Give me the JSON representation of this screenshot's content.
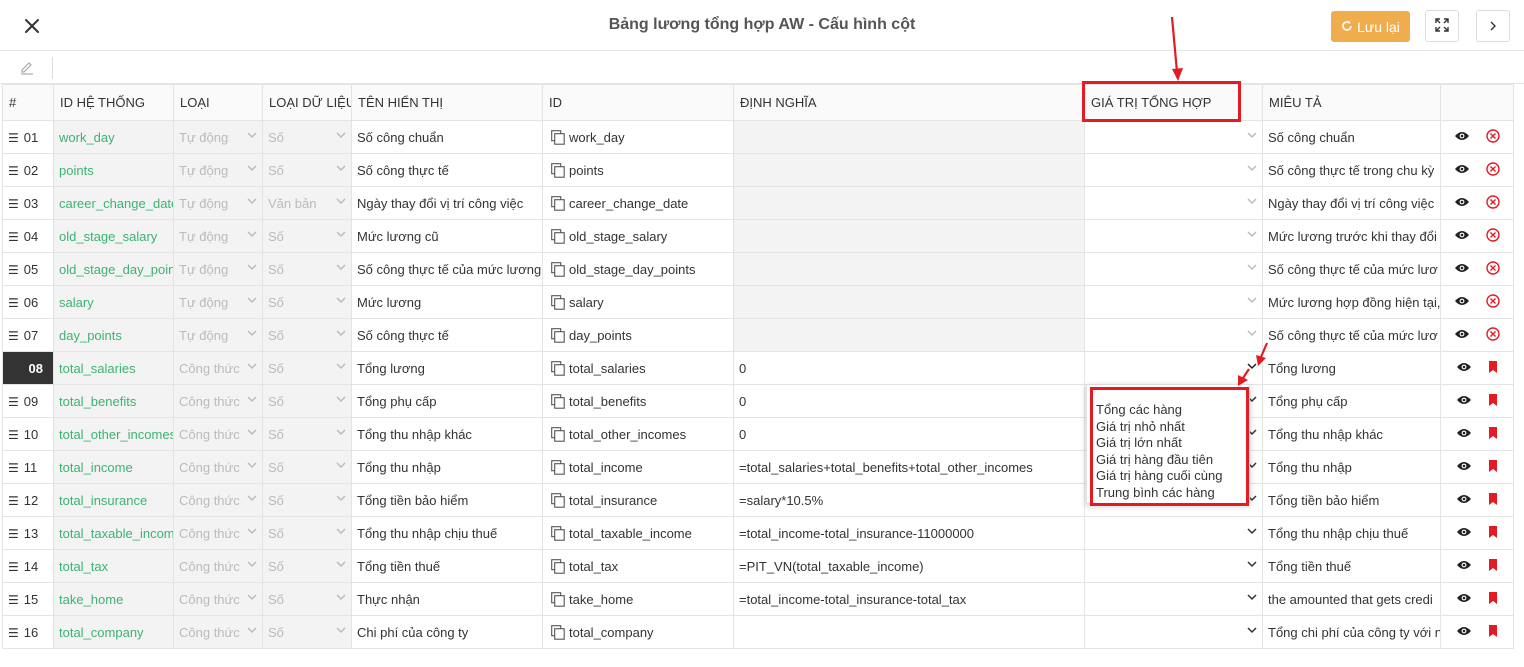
{
  "header": {
    "title": "Bảng lương tổng hợp AW - Cấu hình cột",
    "save_label": "Lưu lại"
  },
  "columns": [
    "#",
    "ID HỆ THỐNG",
    "LOẠI",
    "LOẠI DỮ LIỆU",
    "TÊN HIỂN THỊ",
    "ID",
    "ĐỊNH NGHĨA",
    "GIÁ TRỊ TỔNG HỢP",
    "MIÊU TẢ"
  ],
  "rows": [
    {
      "num": "01",
      "sys_id": "work_day",
      "type": "Tự động",
      "data_type": "Số",
      "display": "Số công chuẩn",
      "id": "work_day",
      "def": "",
      "desc": "Số công chuẩn",
      "action": "delete"
    },
    {
      "num": "02",
      "sys_id": "points",
      "type": "Tự động",
      "data_type": "Số",
      "display": "Số công thực tế",
      "id": "points",
      "def": "",
      "desc": "Số công thực tế trong chu kỳ",
      "action": "delete"
    },
    {
      "num": "03",
      "sys_id": "career_change_date_",
      "type": "Tự động",
      "data_type": "Văn bản",
      "display": "Ngày thay đổi vị trí công việc",
      "id": "career_change_date",
      "def": "",
      "desc": "Ngày thay đổi vị trí công việc",
      "action": "delete"
    },
    {
      "num": "04",
      "sys_id": "old_stage_salary",
      "type": "Tự động",
      "data_type": "Số",
      "display": "Mức lương cũ",
      "id": "old_stage_salary",
      "def": "",
      "desc": "Mức lương trước khi thay đổi",
      "action": "delete"
    },
    {
      "num": "05",
      "sys_id": "old_stage_day_points",
      "type": "Tự động",
      "data_type": "Số",
      "display": "Số công thực tế của mức lương",
      "id": "old_stage_day_points",
      "def": "",
      "desc": "Số công thực tế của mức lươ",
      "action": "delete"
    },
    {
      "num": "06",
      "sys_id": "salary",
      "type": "Tự động",
      "data_type": "Số",
      "display": "Mức lương",
      "id": "salary",
      "def": "",
      "desc": "Mức lương hợp đồng hiện tại,",
      "action": "delete"
    },
    {
      "num": "07",
      "sys_id": "day_points",
      "type": "Tự động",
      "data_type": "Số",
      "display": "Số công thực tế",
      "id": "day_points",
      "def": "",
      "desc": "Số công thực tế của mức lươ",
      "action": "delete"
    },
    {
      "num": "08",
      "sys_id": "total_salaries",
      "type": "Công thức",
      "data_type": "Số",
      "display": "Tổng lương",
      "id": "total_salaries",
      "def": "0",
      "desc": "Tổng lương",
      "action": "bookmark"
    },
    {
      "num": "09",
      "sys_id": "total_benefits",
      "type": "Công thức",
      "data_type": "Số",
      "display": "Tổng phụ cấp",
      "id": "total_benefits",
      "def": "0",
      "desc": "Tổng phụ cấp",
      "action": "bookmark"
    },
    {
      "num": "10",
      "sys_id": "total_other_incomes",
      "type": "Công thức",
      "data_type": "Số",
      "display": "Tổng thu nhập khác",
      "id": "total_other_incomes",
      "def": "0",
      "desc": "Tổng thu nhập khác",
      "action": "bookmark"
    },
    {
      "num": "11",
      "sys_id": "total_income",
      "type": "Công thức",
      "data_type": "Số",
      "display": "Tổng thu nhập",
      "id": "total_income",
      "def": "=total_salaries+total_benefits+total_other_incomes",
      "desc": "Tổng thu nhập",
      "action": "bookmark"
    },
    {
      "num": "12",
      "sys_id": "total_insurance",
      "type": "Công thức",
      "data_type": "Số",
      "display": "Tổng tiền bảo hiểm",
      "id": "total_insurance",
      "def": "=salary*10.5%",
      "desc": "Tổng tiền bảo hiểm",
      "action": "bookmark"
    },
    {
      "num": "13",
      "sys_id": "total_taxable_income",
      "type": "Công thức",
      "data_type": "Số",
      "display": "Tổng thu nhập chịu thuế",
      "id": "total_taxable_income",
      "def": "=total_income-total_insurance-11000000",
      "desc": "Tổng thu nhập chịu thuế",
      "action": "bookmark"
    },
    {
      "num": "14",
      "sys_id": "total_tax",
      "type": "Công thức",
      "data_type": "Số",
      "display": "Tổng tiền thuế",
      "id": "total_tax",
      "def": "=PIT_VN(total_taxable_income)",
      "desc": "Tổng tiền thuế",
      "action": "bookmark"
    },
    {
      "num": "15",
      "sys_id": "take_home",
      "type": "Công thức",
      "data_type": "Số",
      "display": "Thực nhận",
      "id": "take_home",
      "def": "=total_income-total_insurance-total_tax",
      "desc": "the amounted that gets credi",
      "action": "bookmark"
    },
    {
      "num": "16",
      "sys_id": "total_company",
      "type": "Công thức",
      "data_type": "Số",
      "display": "Chi phí của công ty",
      "id": "total_company",
      "def": "",
      "desc": "Tổng chi phí của công ty với n",
      "action": "bookmark"
    }
  ],
  "active_row": "08",
  "aggregate_options": [
    "Tổng các hàng",
    "Giá trị nhỏ nhất",
    "Giá trị lớn nhất",
    "Giá trị hàng đầu tiên",
    "Giá trị hàng cuối cùng",
    "Trung bình các hàng"
  ],
  "colors": {
    "accent": "#f0ad4e",
    "id_green": "#3cb371",
    "delete_red": "#e31b23",
    "highlight_red": "#e31b23"
  }
}
